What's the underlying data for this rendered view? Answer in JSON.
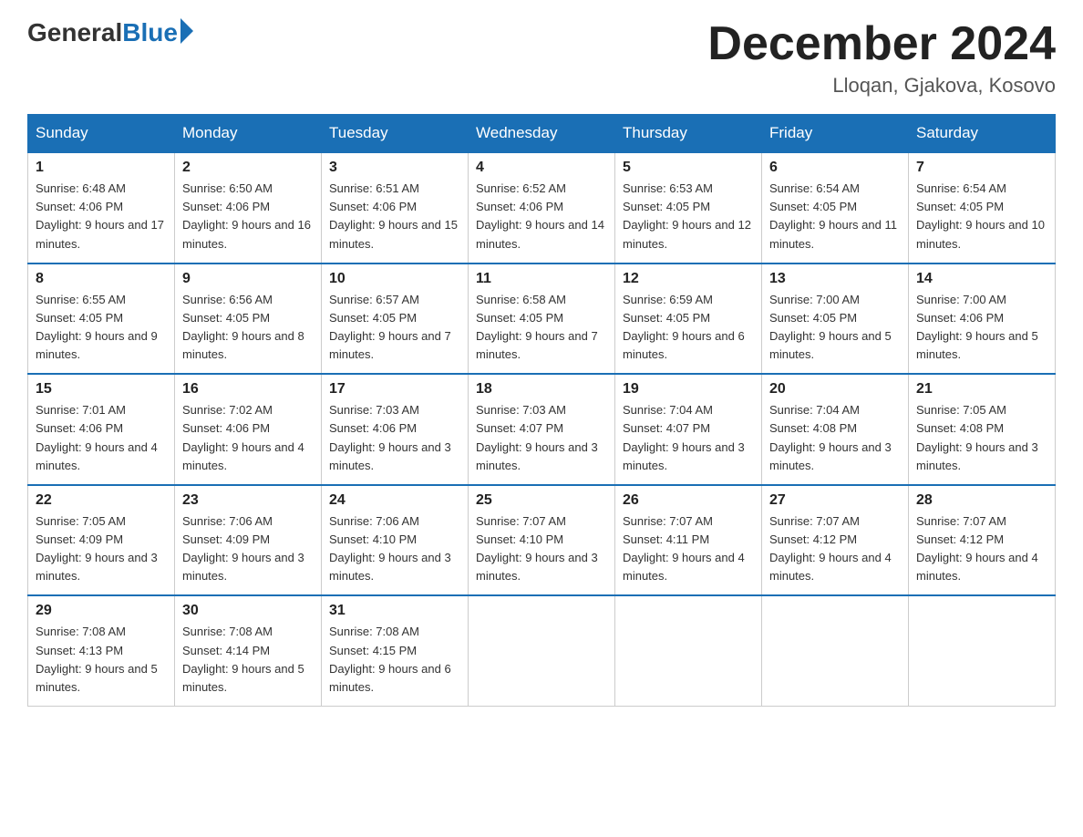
{
  "header": {
    "logo_general": "General",
    "logo_blue": "Blue",
    "month_year": "December 2024",
    "location": "Lloqan, Gjakova, Kosovo"
  },
  "days_of_week": [
    "Sunday",
    "Monday",
    "Tuesday",
    "Wednesday",
    "Thursday",
    "Friday",
    "Saturday"
  ],
  "weeks": [
    [
      {
        "day": "1",
        "sunrise": "6:48 AM",
        "sunset": "4:06 PM",
        "daylight": "9 hours and 17 minutes."
      },
      {
        "day": "2",
        "sunrise": "6:50 AM",
        "sunset": "4:06 PM",
        "daylight": "9 hours and 16 minutes."
      },
      {
        "day": "3",
        "sunrise": "6:51 AM",
        "sunset": "4:06 PM",
        "daylight": "9 hours and 15 minutes."
      },
      {
        "day": "4",
        "sunrise": "6:52 AM",
        "sunset": "4:06 PM",
        "daylight": "9 hours and 14 minutes."
      },
      {
        "day": "5",
        "sunrise": "6:53 AM",
        "sunset": "4:05 PM",
        "daylight": "9 hours and 12 minutes."
      },
      {
        "day": "6",
        "sunrise": "6:54 AM",
        "sunset": "4:05 PM",
        "daylight": "9 hours and 11 minutes."
      },
      {
        "day": "7",
        "sunrise": "6:54 AM",
        "sunset": "4:05 PM",
        "daylight": "9 hours and 10 minutes."
      }
    ],
    [
      {
        "day": "8",
        "sunrise": "6:55 AM",
        "sunset": "4:05 PM",
        "daylight": "9 hours and 9 minutes."
      },
      {
        "day": "9",
        "sunrise": "6:56 AM",
        "sunset": "4:05 PM",
        "daylight": "9 hours and 8 minutes."
      },
      {
        "day": "10",
        "sunrise": "6:57 AM",
        "sunset": "4:05 PM",
        "daylight": "9 hours and 7 minutes."
      },
      {
        "day": "11",
        "sunrise": "6:58 AM",
        "sunset": "4:05 PM",
        "daylight": "9 hours and 7 minutes."
      },
      {
        "day": "12",
        "sunrise": "6:59 AM",
        "sunset": "4:05 PM",
        "daylight": "9 hours and 6 minutes."
      },
      {
        "day": "13",
        "sunrise": "7:00 AM",
        "sunset": "4:05 PM",
        "daylight": "9 hours and 5 minutes."
      },
      {
        "day": "14",
        "sunrise": "7:00 AM",
        "sunset": "4:06 PM",
        "daylight": "9 hours and 5 minutes."
      }
    ],
    [
      {
        "day": "15",
        "sunrise": "7:01 AM",
        "sunset": "4:06 PM",
        "daylight": "9 hours and 4 minutes."
      },
      {
        "day": "16",
        "sunrise": "7:02 AM",
        "sunset": "4:06 PM",
        "daylight": "9 hours and 4 minutes."
      },
      {
        "day": "17",
        "sunrise": "7:03 AM",
        "sunset": "4:06 PM",
        "daylight": "9 hours and 3 minutes."
      },
      {
        "day": "18",
        "sunrise": "7:03 AM",
        "sunset": "4:07 PM",
        "daylight": "9 hours and 3 minutes."
      },
      {
        "day": "19",
        "sunrise": "7:04 AM",
        "sunset": "4:07 PM",
        "daylight": "9 hours and 3 minutes."
      },
      {
        "day": "20",
        "sunrise": "7:04 AM",
        "sunset": "4:08 PM",
        "daylight": "9 hours and 3 minutes."
      },
      {
        "day": "21",
        "sunrise": "7:05 AM",
        "sunset": "4:08 PM",
        "daylight": "9 hours and 3 minutes."
      }
    ],
    [
      {
        "day": "22",
        "sunrise": "7:05 AM",
        "sunset": "4:09 PM",
        "daylight": "9 hours and 3 minutes."
      },
      {
        "day": "23",
        "sunrise": "7:06 AM",
        "sunset": "4:09 PM",
        "daylight": "9 hours and 3 minutes."
      },
      {
        "day": "24",
        "sunrise": "7:06 AM",
        "sunset": "4:10 PM",
        "daylight": "9 hours and 3 minutes."
      },
      {
        "day": "25",
        "sunrise": "7:07 AM",
        "sunset": "4:10 PM",
        "daylight": "9 hours and 3 minutes."
      },
      {
        "day": "26",
        "sunrise": "7:07 AM",
        "sunset": "4:11 PM",
        "daylight": "9 hours and 4 minutes."
      },
      {
        "day": "27",
        "sunrise": "7:07 AM",
        "sunset": "4:12 PM",
        "daylight": "9 hours and 4 minutes."
      },
      {
        "day": "28",
        "sunrise": "7:07 AM",
        "sunset": "4:12 PM",
        "daylight": "9 hours and 4 minutes."
      }
    ],
    [
      {
        "day": "29",
        "sunrise": "7:08 AM",
        "sunset": "4:13 PM",
        "daylight": "9 hours and 5 minutes."
      },
      {
        "day": "30",
        "sunrise": "7:08 AM",
        "sunset": "4:14 PM",
        "daylight": "9 hours and 5 minutes."
      },
      {
        "day": "31",
        "sunrise": "7:08 AM",
        "sunset": "4:15 PM",
        "daylight": "9 hours and 6 minutes."
      },
      null,
      null,
      null,
      null
    ]
  ]
}
